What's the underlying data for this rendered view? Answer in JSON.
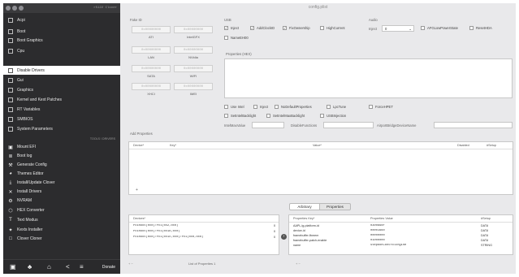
{
  "sidebar": {
    "version": "r5122 Clover",
    "items": [
      {
        "label": "Acpi"
      },
      {
        "label": "Boot"
      },
      {
        "label": "Boot Graphics"
      },
      {
        "label": "Cpu"
      },
      {
        "label": "Disable Drivers"
      },
      {
        "label": "Gui"
      },
      {
        "label": "Graphics"
      },
      {
        "label": "Kernel and Kext Patches"
      },
      {
        "label": "RT Variables"
      },
      {
        "label": "SMBIOS"
      },
      {
        "label": "System Parameters"
      }
    ],
    "tools_header": "TOOLS / DRIVERS",
    "tools": [
      {
        "label": "Mount EFI",
        "icon": "disk-icon"
      },
      {
        "label": "Boot log",
        "icon": "log-icon"
      },
      {
        "label": "Generate Config",
        "icon": "wrench-icon"
      },
      {
        "label": "Themes Editor",
        "icon": "palette-icon"
      },
      {
        "label": "Install/Update Clover",
        "icon": "download-icon"
      },
      {
        "label": "Install Drivers",
        "icon": "tools-icon"
      },
      {
        "label": "NVRAM",
        "icon": "gear-icon"
      },
      {
        "label": "HEX Converter",
        "icon": "hex-icon"
      },
      {
        "label": "Text Modus",
        "icon": "text-icon"
      },
      {
        "label": "Kexts Installer",
        "icon": "kexts-icon"
      },
      {
        "label": "Clover Cloner",
        "icon": "cloner-icon"
      }
    ],
    "bottom": {
      "donate": "Donate"
    }
  },
  "main": {
    "title": "config.plist",
    "fake_id": {
      "label": "Fake ID",
      "fields": [
        {
          "value": "0x00000000",
          "caption": "ATI"
        },
        {
          "value": "0x00000000",
          "caption": "IntelGFX"
        },
        {
          "value": "0x00000000",
          "caption": "LAN"
        },
        {
          "value": "0x00000000",
          "caption": "NVidia"
        },
        {
          "value": "0x00000000",
          "caption": "SATA"
        },
        {
          "value": "0x00000000",
          "caption": "WIFI"
        },
        {
          "value": "0x00000000",
          "caption": "XHCI"
        },
        {
          "value": "0x00000000",
          "caption": "IMEI"
        }
      ]
    },
    "usb": {
      "label": "USB",
      "checks": [
        {
          "label": "Inject",
          "checked": true
        },
        {
          "label": "AddClockID",
          "checked": true
        },
        {
          "label": "FixOwnership",
          "checked": true
        },
        {
          "label": "HighCurrent",
          "checked": false
        },
        {
          "label": "NameEH00",
          "checked": false
        }
      ]
    },
    "audio": {
      "label": "Audio",
      "inject_label": "Inject",
      "inject_value": "0",
      "checks": [
        {
          "label": "AFGLowPowerState",
          "checked": false
        },
        {
          "label": "ResetHDA",
          "checked": false
        }
      ]
    },
    "properties": {
      "label": "Properties (HEX)"
    },
    "options": [
      {
        "label": "Use Intel",
        "checked": false
      },
      {
        "label": "Inject",
        "checked": false
      },
      {
        "label": "NoDefaultProperties",
        "checked": false
      },
      {
        "label": "LpcTune",
        "checked": false
      },
      {
        "label": "ForceHPET",
        "checked": false
      },
      {
        "label": "SetIntelBacklight",
        "checked": false
      },
      {
        "label": "SetIntelMaxBacklight",
        "checked": false
      },
      {
        "label": "USBInjection",
        "checked": false
      },
      {
        "label": "DisableFunctions",
        "checked": false
      }
    ],
    "options_row2": {
      "ifield1_label": "IntelMaxValue",
      "ifield2_label": "DisableFunctions",
      "ifield3_label": "AirportBridgeDeviceName"
    },
    "add_properties": {
      "label": "Add Properties",
      "columns": [
        "Device*",
        "Key*",
        "Value*",
        "Disabled",
        "#Setup"
      ]
    },
    "segments": {
      "left": "Arbitrary",
      "right": "Properties"
    },
    "devices": {
      "header": "Devices*",
      "rows": [
        {
          "path": "PciRoot(0x0)/Pci(0x2,0x0)",
          "n": "0"
        },
        {
          "path": "PciRoot(0x0)/Pci(0x1b,0x0)",
          "n": "0"
        },
        {
          "path": "PciRoot(0x0)/Pci(0x1c,0x0)/Pci(0x0,0x0)",
          "n": "0"
        }
      ]
    },
    "prop_table": {
      "columns": [
        "Properties Key*",
        "Properties Value",
        "#Setup"
      ],
      "rows": [
        {
          "key": "AAPL,ig-platform-id",
          "value": "0300660F",
          "type": "DATA"
        },
        {
          "key": "device-id",
          "value": "00001660",
          "type": "DATA"
        },
        {
          "key": "framebuffer-fbmem",
          "value": "00000000",
          "type": "DATA"
        },
        {
          "key": "framebuffer-patch-enable",
          "value": "01000000",
          "type": "DATA"
        },
        {
          "key": "name",
          "value": "StepbonControlEngine",
          "type": "STRING"
        }
      ]
    },
    "footer": {
      "text": "List of Properties 1"
    }
  }
}
